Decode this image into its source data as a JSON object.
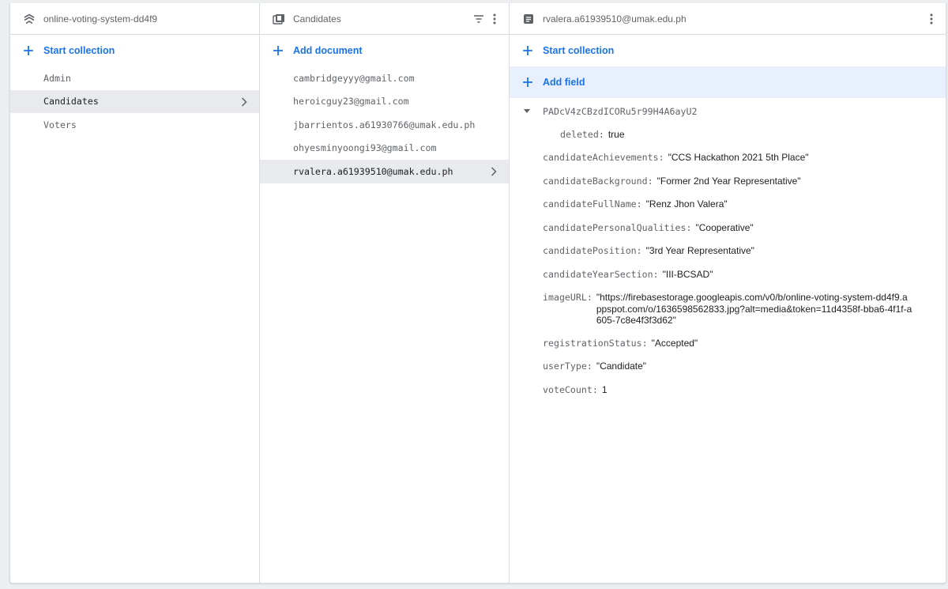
{
  "project": {
    "name": "online-voting-system-dd4f9"
  },
  "root_panel": {
    "action_label": "Start collection",
    "collections": [
      {
        "name": "Admin",
        "selected": false
      },
      {
        "name": "Candidates",
        "selected": true
      },
      {
        "name": "Voters",
        "selected": false
      }
    ]
  },
  "collection_panel": {
    "title": "Candidates",
    "action_label": "Add document",
    "documents": [
      {
        "id": "cambridgeyyy@gmail.com",
        "selected": false
      },
      {
        "id": "heroicguy23@gmail.com",
        "selected": false
      },
      {
        "id": "jbarrientos.a61930766@umak.edu.ph",
        "selected": false
      },
      {
        "id": "ohyesminyoongi93@gmail.com",
        "selected": false
      },
      {
        "id": "rvalera.a61939510@umak.edu.ph",
        "selected": true
      }
    ]
  },
  "document_panel": {
    "title": "rvalera.a61939510@umak.edu.ph",
    "start_collection_label": "Start collection",
    "add_field_label": "Add field",
    "map_field": {
      "key": "PADcV4zCBzdICORu5r99H4A6ayU2",
      "children": [
        {
          "key": "deleted:",
          "value": "true"
        }
      ]
    },
    "fields": [
      {
        "key": "candidateAchievements:",
        "value": "\"CCS Hackathon 2021 5th Place\""
      },
      {
        "key": "candidateBackground:",
        "value": "\"Former 2nd Year Representative\""
      },
      {
        "key": "candidateFullName:",
        "value": "\"Renz Jhon Valera\""
      },
      {
        "key": "candidatePersonalQualities:",
        "value": "\"Cooperative\""
      },
      {
        "key": "candidatePosition:",
        "value": "\"3rd Year Representative\""
      },
      {
        "key": "candidateYearSection:",
        "value": "\"III-BCSAD\""
      },
      {
        "key": "imageURL:",
        "value": "\"https://firebasestorage.googleapis.com/v0/b/online-voting-system-dd4f9.appspot.com/o/1636598562833.jpg?alt=media&token=11d4358f-bba6-4f1f-a605-7c8e4f3f3d62\""
      },
      {
        "key": "registrationStatus:",
        "value": "\"Accepted\""
      },
      {
        "key": "userType:",
        "value": "\"Candidate\""
      },
      {
        "key": "voteCount:",
        "value": "1"
      }
    ]
  },
  "colors": {
    "accent": "#1a73e8",
    "selected_row": "#e8eaed",
    "highlight_row": "#e8f0fe",
    "muted_text": "#5f6368",
    "border": "#dadce0"
  },
  "icons": {
    "project": "firestore-root-icon",
    "collection": "collection-icon",
    "document": "document-icon",
    "filter": "filter-icon",
    "more": "more-vert-icon",
    "add": "plus-icon",
    "chevron": "chevron-right-icon",
    "caret": "caret-down-icon"
  }
}
